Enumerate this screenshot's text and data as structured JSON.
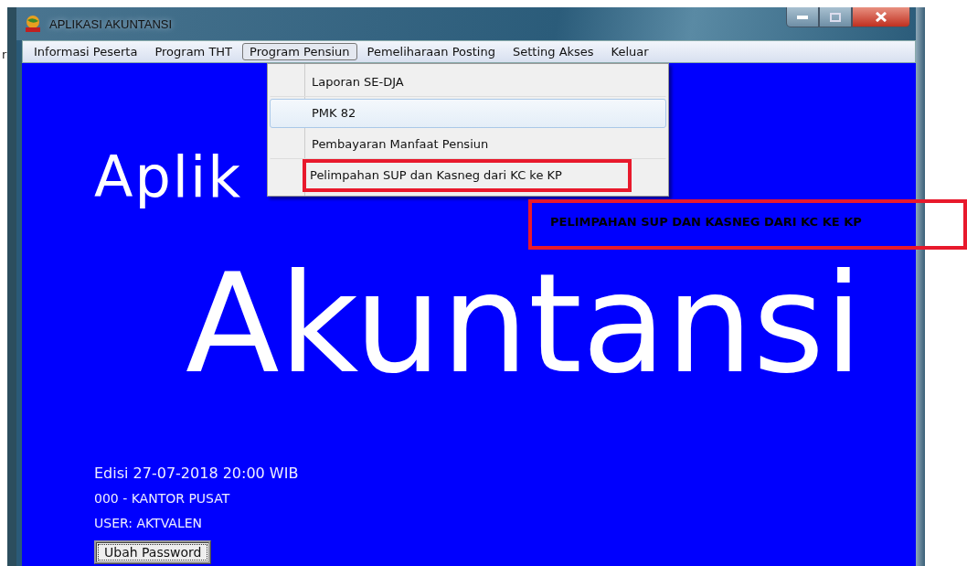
{
  "desktop_fragment": "r",
  "window": {
    "title": "APLIKASI AKUNTANSI"
  },
  "menu_bar": [
    {
      "label": "Informasi Peserta",
      "selected": false
    },
    {
      "label": "Program THT",
      "selected": false
    },
    {
      "label": "Program Pensiun",
      "selected": true
    },
    {
      "label": "Pemeliharaan Posting",
      "selected": false
    },
    {
      "label": "Setting Akses",
      "selected": false
    },
    {
      "label": "Keluar",
      "selected": false
    }
  ],
  "dropdown": [
    {
      "label": "Laporan SE-DJA",
      "selected": false,
      "marked": false
    },
    {
      "label": "PMK 82",
      "selected": true,
      "marked": false
    },
    {
      "label": "Pembayaran Manfaat Pensiun",
      "selected": false,
      "marked": false
    },
    {
      "label": "Pelimpahan SUP dan Kasneg dari KC ke KP",
      "selected": false,
      "marked": true
    }
  ],
  "splash": {
    "title_line_1": "Aplik",
    "title_line_2": "Akuntansi",
    "edition": "Edisi 27-07-2018 20:00 WIB",
    "office": "000 - KANTOR PUSAT",
    "user": "USER: AKTVALEN",
    "button": "Ubah Password"
  },
  "annotation": {
    "text": "PELIMPAHAN SUP DAN KASNEG DARI KC KE KP"
  }
}
